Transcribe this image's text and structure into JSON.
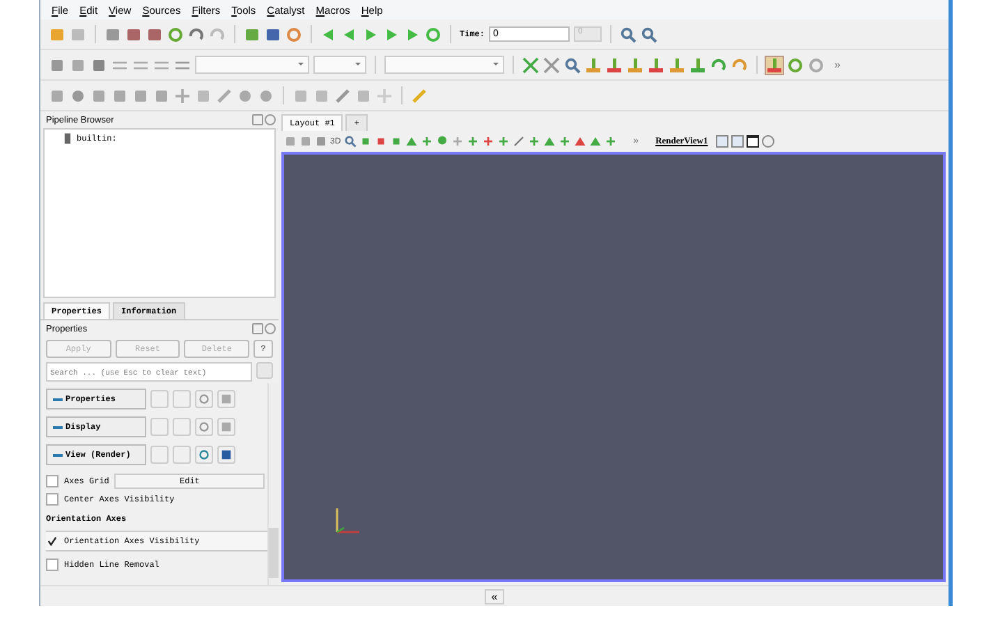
{
  "menu": [
    {
      "label": "File"
    },
    {
      "label": "Edit"
    },
    {
      "label": "View"
    },
    {
      "label": "Sources"
    },
    {
      "label": "Filters"
    },
    {
      "label": "Tools"
    },
    {
      "label": "Catalyst"
    },
    {
      "label": "Macros"
    },
    {
      "label": "Help"
    }
  ],
  "time": {
    "label": "Time:",
    "value": "0",
    "step": "0"
  },
  "layout_tabs": [
    {
      "label": "Layout #1",
      "selected": true
    },
    {
      "label": "+",
      "selected": false
    }
  ],
  "view_toolbar": {
    "mode_label": "3D",
    "more": "»",
    "view_name": "RenderView1"
  },
  "toolbar_more": "»",
  "pipeline": {
    "title": "Pipeline Browser",
    "items": [
      {
        "label": "builtin:"
      }
    ]
  },
  "panel_tabs": [
    {
      "label": "Properties",
      "selected": true
    },
    {
      "label": "Information",
      "selected": false
    }
  ],
  "properties": {
    "title": "Properties",
    "buttons": [
      {
        "label": "Apply",
        "disabled": true
      },
      {
        "label": "Reset",
        "disabled": true
      },
      {
        "label": "Delete",
        "disabled": true
      },
      {
        "label": "?",
        "disabled": false
      }
    ],
    "search": {
      "placeholder": "Search ... (use Esc to clear text)"
    },
    "sections": [
      {
        "label": "Properties",
        "active": false
      },
      {
        "label": "Display",
        "active": false
      },
      {
        "label": "View (Render)",
        "active": true
      }
    ],
    "options": [
      {
        "kind": "check",
        "label": "Axes Grid",
        "checked": false,
        "button": "Edit"
      },
      {
        "kind": "check",
        "label": "Center Axes Visibility",
        "checked": false
      },
      {
        "kind": "header",
        "label": "Orientation Axes"
      },
      {
        "kind": "check",
        "label": "Orientation Axes Visibility",
        "checked": true
      },
      {
        "kind": "check",
        "label": "Hidden Line Removal",
        "checked": false
      }
    ]
  },
  "status_bar": {
    "toggle": "«"
  }
}
